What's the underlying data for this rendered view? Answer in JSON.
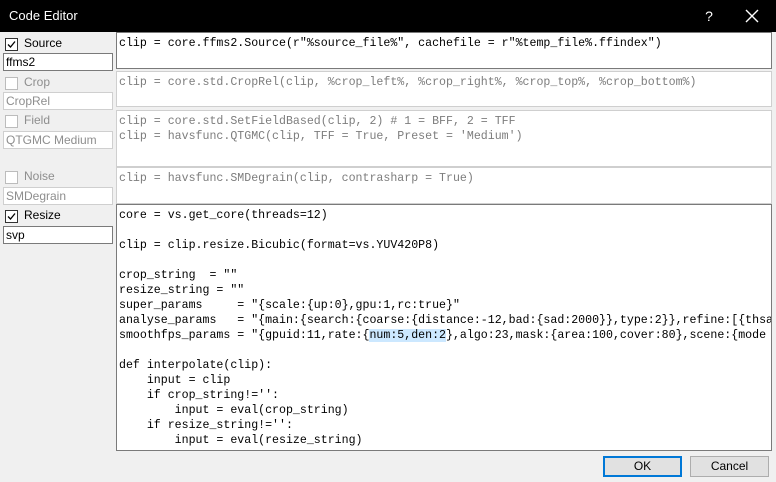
{
  "window": {
    "title": "Code Editor",
    "help_label": "?"
  },
  "sections": [
    {
      "id": "source",
      "label": "Source",
      "checked": true,
      "enabled": true,
      "value": "ffms2",
      "code": [
        "clip = core.ffms2.Source(r\"%source_file%\", cachefile = r\"%temp_file%.ffindex\")"
      ]
    },
    {
      "id": "crop",
      "label": "Crop",
      "checked": false,
      "enabled": false,
      "value": "CropRel",
      "code": [
        "clip = core.std.CropRel(clip, %crop_left%, %crop_right%, %crop_top%, %crop_bottom%)"
      ]
    },
    {
      "id": "field",
      "label": "Field",
      "checked": false,
      "enabled": false,
      "value": "QTGMC Medium",
      "code": [
        "clip = core.std.SetFieldBased(clip, 2) # 1 = BFF, 2 = TFF",
        "clip = havsfunc.QTGMC(clip, TFF = True, Preset = 'Medium')"
      ]
    },
    {
      "id": "noise",
      "label": "Noise",
      "checked": false,
      "enabled": false,
      "value": "SMDegrain",
      "code": [
        "clip = havsfunc.SMDegrain(clip, contrasharp = True)"
      ]
    },
    {
      "id": "resize",
      "label": "Resize",
      "checked": true,
      "enabled": true,
      "value": "svp",
      "code": [
        "core = vs.get_core(threads=12)",
        "",
        "clip = clip.resize.Bicubic(format=vs.YUV420P8)",
        "",
        "crop_string  = \"\"",
        "resize_string = \"\"",
        "super_params     = \"{scale:{up:0},gpu:1,rc:true}\"",
        "analyse_params   = \"{main:{search:{coarse:{distance:-12,bad:{sad:2000}},type:2}},refine:[{thsa",
        "smoothfps_params = \"{gpuid:11,rate:{num:5,den:2},algo:23,mask:{area:100,cover:80},scene:{mode",
        "",
        "def interpolate(clip):",
        "    input = clip",
        "    if crop_string!='':",
        "        input = eval(crop_string)",
        "    if resize_string!='':",
        "        input = eval(resize_string)"
      ],
      "selection": {
        "line": 8,
        "text": "num:5,den:2"
      }
    }
  ],
  "buttons": {
    "ok": "OK",
    "cancel": "Cancel"
  }
}
